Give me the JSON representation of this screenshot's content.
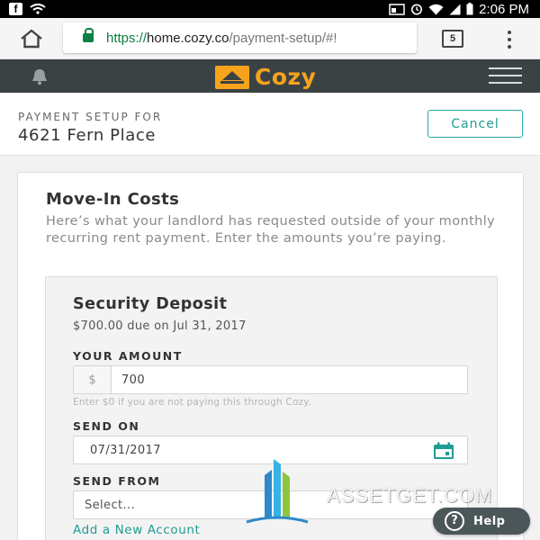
{
  "status_bar": {
    "time": "2:06 PM",
    "icons": [
      "facebook-icon",
      "wifi-icon",
      "cast-icon",
      "alarm-icon",
      "wifi-signal-icon",
      "cell-signal-icon",
      "battery-icon"
    ]
  },
  "browser": {
    "url_scheme": "https://",
    "url_host": "home.cozy.co",
    "url_path": "/payment-setup/#!",
    "tab_count": "5"
  },
  "app_header": {
    "logo_text": "Cozy",
    "brand_color": "#f7a31c",
    "header_bg": "#3b4244"
  },
  "page_header": {
    "label": "PAYMENT SETUP FOR",
    "address": "4621 Fern Place",
    "cancel_label": "Cancel"
  },
  "move_in": {
    "title": "Move-In Costs",
    "description": "Here’s what your landlord has requested outside of your monthly recurring rent payment. Enter the amounts you’re paying."
  },
  "security_deposit": {
    "title": "Security Deposit",
    "due_text": "$700.00 due on Jul 31, 2017",
    "amount_label": "YOUR AMOUNT",
    "currency_symbol": "$",
    "amount_value": "700",
    "amount_hint": "Enter $0 if you are not paying this through Cozy.",
    "send_on_label": "SEND ON",
    "send_on_value": "07/31/2017",
    "send_from_label": "SEND FROM",
    "send_from_value": "Select...",
    "add_account_link": "Add a New Account"
  },
  "help": {
    "label": "Help"
  },
  "watermark": {
    "text": "ASSETGET.COM"
  },
  "accent_color": "#1f9c93"
}
